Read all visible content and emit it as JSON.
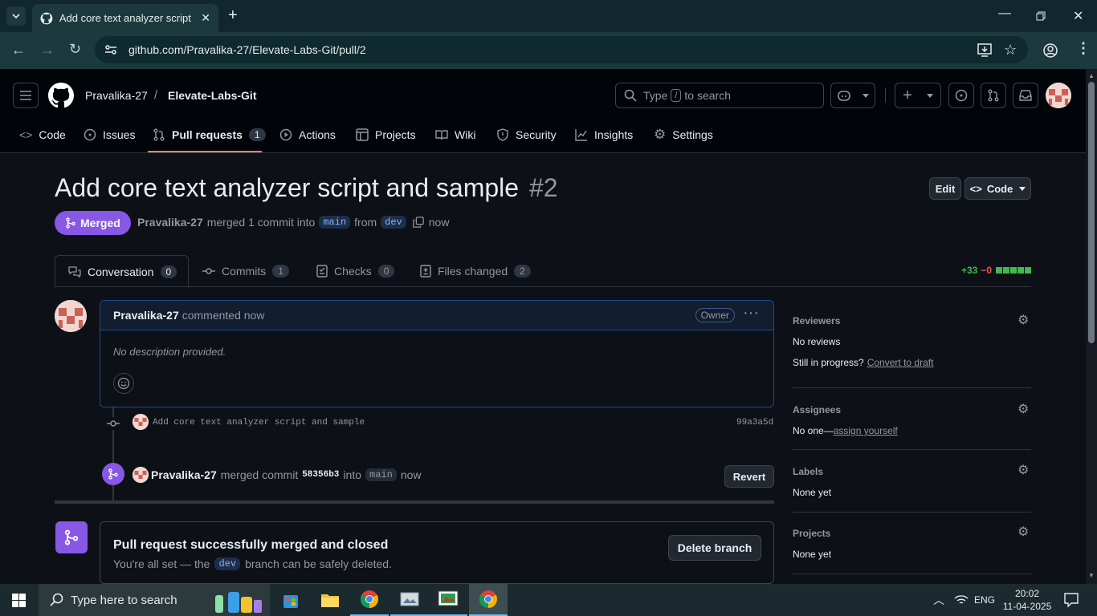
{
  "browser": {
    "tab_title": "Add core text analyzer script an",
    "url": "github.com/Pravalika-27/Elevate-Labs-Git/pull/2"
  },
  "header": {
    "owner": "Pravalika-27",
    "separator": "/",
    "repo": "Elevate-Labs-Git",
    "search_prefix": "Type",
    "search_key": "/",
    "search_suffix": "to search"
  },
  "nav": {
    "code": "Code",
    "issues": "Issues",
    "pull_requests": "Pull requests",
    "pull_requests_count": "1",
    "actions": "Actions",
    "projects": "Projects",
    "wiki": "Wiki",
    "security": "Security",
    "insights": "Insights",
    "settings": "Settings"
  },
  "pr": {
    "title": "Add core text analyzer script and sample",
    "number": "#2",
    "edit_label": "Edit",
    "code_label": "Code",
    "state": "Merged",
    "author": "Pravalika-27",
    "merged_text": "merged 1 commit into",
    "base": "main",
    "from": "from",
    "head": "dev",
    "time": "now"
  },
  "tabs": {
    "conversation": "Conversation",
    "conversation_count": "0",
    "commits": "Commits",
    "commits_count": "1",
    "checks": "Checks",
    "checks_count": "0",
    "files": "Files changed",
    "files_count": "2",
    "additions": "+33",
    "deletions": "−0"
  },
  "comment": {
    "author": "Pravalika-27",
    "meta": "commented now",
    "badge": "Owner",
    "body": "No description provided."
  },
  "timeline": {
    "commit_message": "Add core text analyzer script and sample",
    "commit_sha": "99a3a5d",
    "merge_author": "Pravalika-27",
    "merge_text": "merged commit",
    "merge_sha": "58356b3",
    "merge_into": "into",
    "merge_branch": "main",
    "merge_time": "now",
    "revert_label": "Revert"
  },
  "merge_box": {
    "title": "Pull request successfully merged and closed",
    "text_prefix": "You're all set — the",
    "branch": "dev",
    "text_suffix": "branch can be safely deleted.",
    "delete_label": "Delete branch"
  },
  "sidebar": {
    "reviewers_title": "Reviewers",
    "reviewers_value": "No reviews",
    "progress_label": "Still in progress?",
    "progress_link": "Convert to draft",
    "assignees_title": "Assignees",
    "assignees_value": "No one—",
    "assignees_link": "assign yourself",
    "labels_title": "Labels",
    "labels_value": "None yet",
    "projects_title": "Projects",
    "projects_value": "None yet"
  },
  "taskbar": {
    "search_placeholder": "Type here to search",
    "language": "ENG",
    "time": "20:02",
    "date": "11-04-2025"
  },
  "colors": {
    "merged_purple": "#8957e5",
    "link_blue": "#4493f8",
    "additions_green": "#3fb950",
    "deletions_red": "#f85149"
  }
}
